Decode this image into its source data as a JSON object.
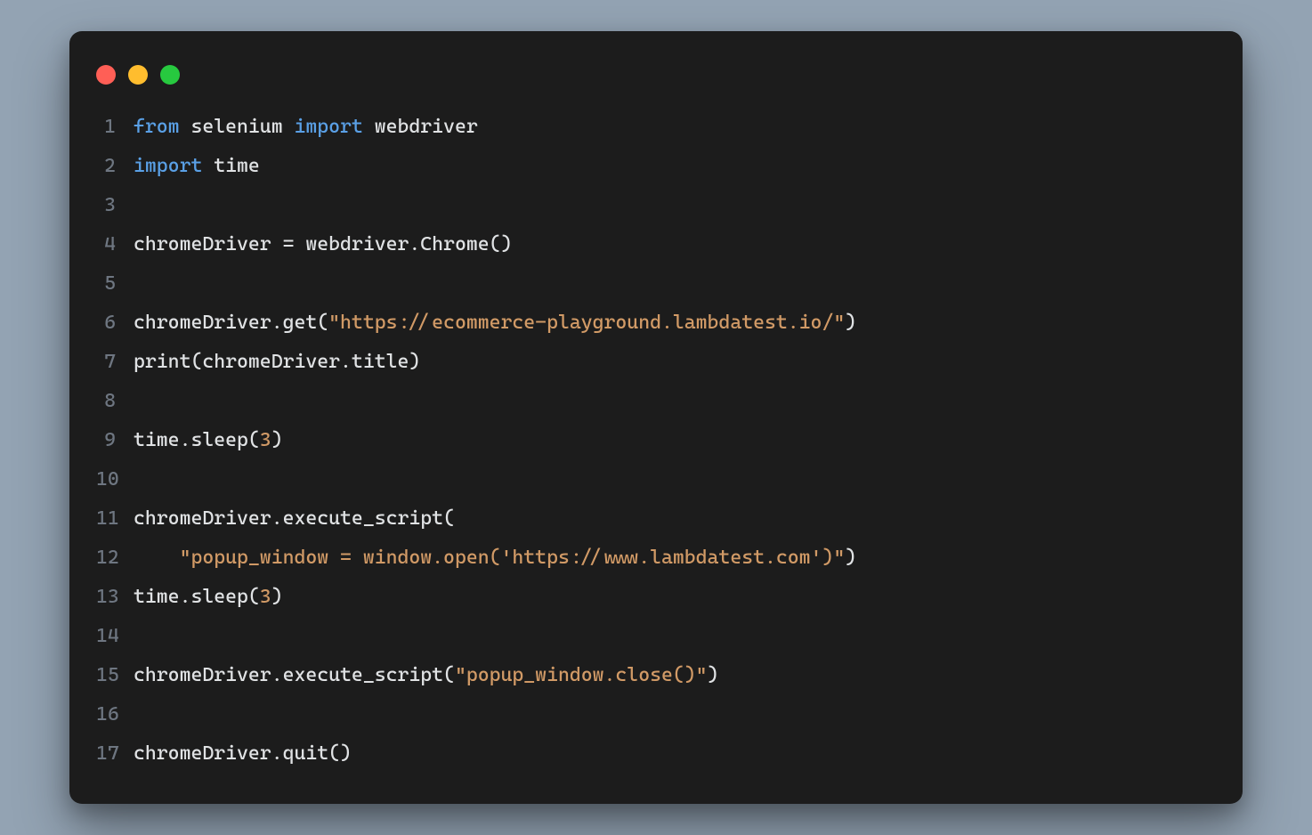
{
  "window": {
    "traffic_lights": [
      "close",
      "minimize",
      "zoom"
    ]
  },
  "code": {
    "syntax": {
      "keywords": [
        "from",
        "import"
      ],
      "strings": [
        "\"https://ecommerce-playground.lambdatest.io/\"",
        "\"popup_window = window.open('https://www.lambdatest.com')\"",
        "\"popup_window.close()\"",
        "3"
      ]
    },
    "lines": [
      {
        "n": "1",
        "tokens": [
          [
            "kw",
            "from"
          ],
          [
            "def",
            " selenium "
          ],
          [
            "kw",
            "import"
          ],
          [
            "def",
            " webdriver"
          ]
        ]
      },
      {
        "n": "2",
        "tokens": [
          [
            "kw",
            "import"
          ],
          [
            "def",
            " time"
          ]
        ]
      },
      {
        "n": "3",
        "tokens": []
      },
      {
        "n": "4",
        "tokens": [
          [
            "def",
            "chromeDriver = webdriver.Chrome()"
          ]
        ]
      },
      {
        "n": "5",
        "tokens": []
      },
      {
        "n": "6",
        "tokens": [
          [
            "def",
            "chromeDriver.get("
          ],
          [
            "str",
            "\"https://ecommerce-playground.lambdatest.io/\""
          ],
          [
            "def",
            ")"
          ]
        ]
      },
      {
        "n": "7",
        "tokens": [
          [
            "def",
            "print(chromeDriver.title)"
          ]
        ]
      },
      {
        "n": "8",
        "tokens": []
      },
      {
        "n": "9",
        "tokens": [
          [
            "def",
            "time.sleep("
          ],
          [
            "num",
            "3"
          ],
          [
            "def",
            ")"
          ]
        ]
      },
      {
        "n": "10",
        "tokens": []
      },
      {
        "n": "11",
        "tokens": [
          [
            "def",
            "chromeDriver.execute_script("
          ]
        ]
      },
      {
        "n": "12",
        "tokens": [
          [
            "def",
            "    "
          ],
          [
            "str",
            "\"popup_window = window.open('https://www.lambdatest.com')\""
          ],
          [
            "def",
            ")"
          ]
        ]
      },
      {
        "n": "13",
        "tokens": [
          [
            "def",
            "time.sleep("
          ],
          [
            "num",
            "3"
          ],
          [
            "def",
            ")"
          ]
        ]
      },
      {
        "n": "14",
        "tokens": []
      },
      {
        "n": "15",
        "tokens": [
          [
            "def",
            "chromeDriver.execute_script("
          ],
          [
            "str",
            "\"popup_window.close()\""
          ],
          [
            "def",
            ")"
          ]
        ]
      },
      {
        "n": "16",
        "tokens": []
      },
      {
        "n": "17",
        "tokens": [
          [
            "def",
            "chromeDriver.quit()"
          ]
        ]
      }
    ]
  }
}
